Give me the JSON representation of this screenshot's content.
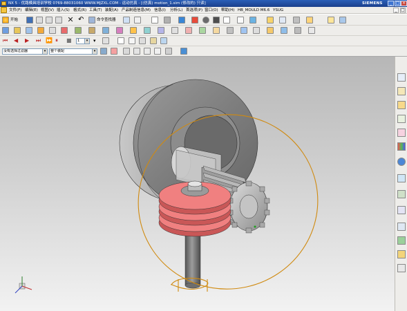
{
  "title_bar": {
    "title": "NX 5 - 优路模具培训学校 0769-88031060 WWW.MJZXL.COM - 运动仿真 - [(仿真) motion_1.sim (修改的) 只读]",
    "brand": "SIEMENS"
  },
  "menu": {
    "items": [
      "文件(F)",
      "编辑(E)",
      "视图(V)",
      "插入(S)",
      "格式(R)",
      "工具(T)",
      "装配(A)",
      "产品制造信息(M)",
      "信息(I)",
      "分析(L)",
      "首选项(P)",
      "窗口(O)",
      "帮助(H)",
      "HB_MOULD M6.6",
      "YSUG"
    ]
  },
  "toolbar1": {
    "start_label": "开始",
    "command_finder_label": "命令查找器"
  },
  "toolbar2": {
    "step_value": "1"
  },
  "toolbar3": {
    "selection_filter": "没有选择过滤器",
    "assembly_scope": "整个装配"
  },
  "icons": {
    "title": "nx-app-icon",
    "start": "start-icon",
    "triad": "wcs-triad-icon"
  },
  "colors": {
    "viewport_top": "#b7b7b7",
    "viewport_bottom": "#f2f2f2",
    "title_bar": "#2b5fb8",
    "worm_wheel": "#f08080",
    "trajectory": "#d08a10"
  }
}
